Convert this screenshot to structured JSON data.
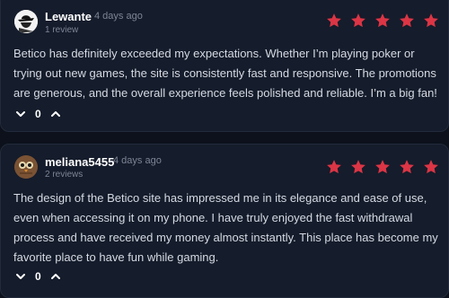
{
  "reviews": [
    {
      "username": "Lewante",
      "date": "4 days ago",
      "review_count": "1 review",
      "rating": 5,
      "text": "Betico has definitely exceeded my expectations. Whether I’m playing poker or trying out new games, the site is consistently fast and responsive. The promotions are generous, and the overall experience feels polished and reliable. I’m a big fan!",
      "vote_count": "0"
    },
    {
      "username": "meliana5455",
      "date": "4 days ago",
      "review_count": "2 reviews",
      "rating": 5,
      "text": "The design of the Betico site has impressed me in its elegance and ease of use, even when accessing it on my phone. I have truly enjoyed the fast withdrawal process and have received my money almost instantly. This place has become my favorite place to have fun while gaming.",
      "vote_count": "0"
    }
  ],
  "colors": {
    "star": "#dc3545",
    "background": "#0c111b",
    "card": "#151c2b"
  }
}
